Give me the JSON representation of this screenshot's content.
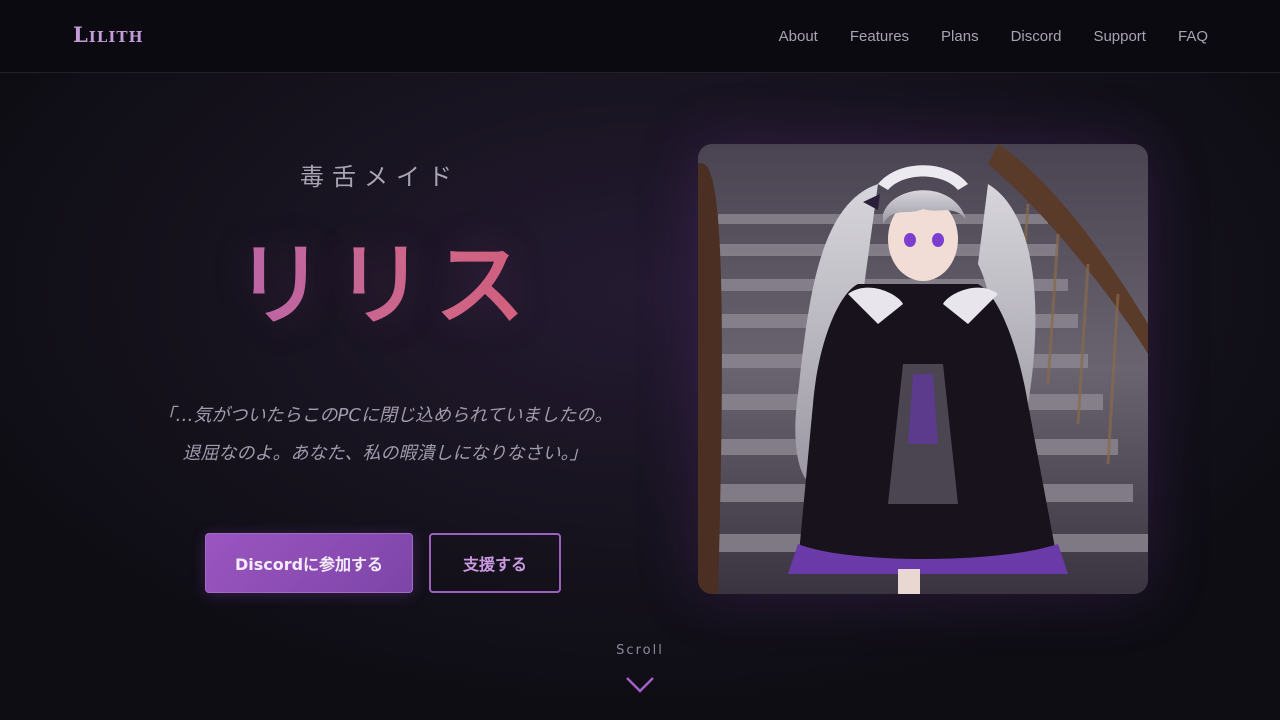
{
  "header": {
    "logo": "Lilith",
    "nav": [
      "About",
      "Features",
      "Plans",
      "Discord",
      "Support",
      "FAQ"
    ]
  },
  "hero": {
    "subtitle": "毒舌メイド",
    "title": "リリス",
    "quote_line1": "「…気がついたらこのPCに閉じ込められていましたの。",
    "quote_line2": "退屈なのよ。あなた、私の暇潰しになりなさい。」",
    "primary_button": "Discordに参加する",
    "secondary_button": "支援する",
    "image_icon": "maid-character-illustration"
  },
  "scroll": {
    "label": "Scroll",
    "icon": "chevron-down-icon"
  },
  "colors": {
    "accent": "#9b55c0",
    "title_gradient_start": "#b667b8",
    "title_gradient_end": "#d85a74",
    "background": "#0d0c13"
  }
}
